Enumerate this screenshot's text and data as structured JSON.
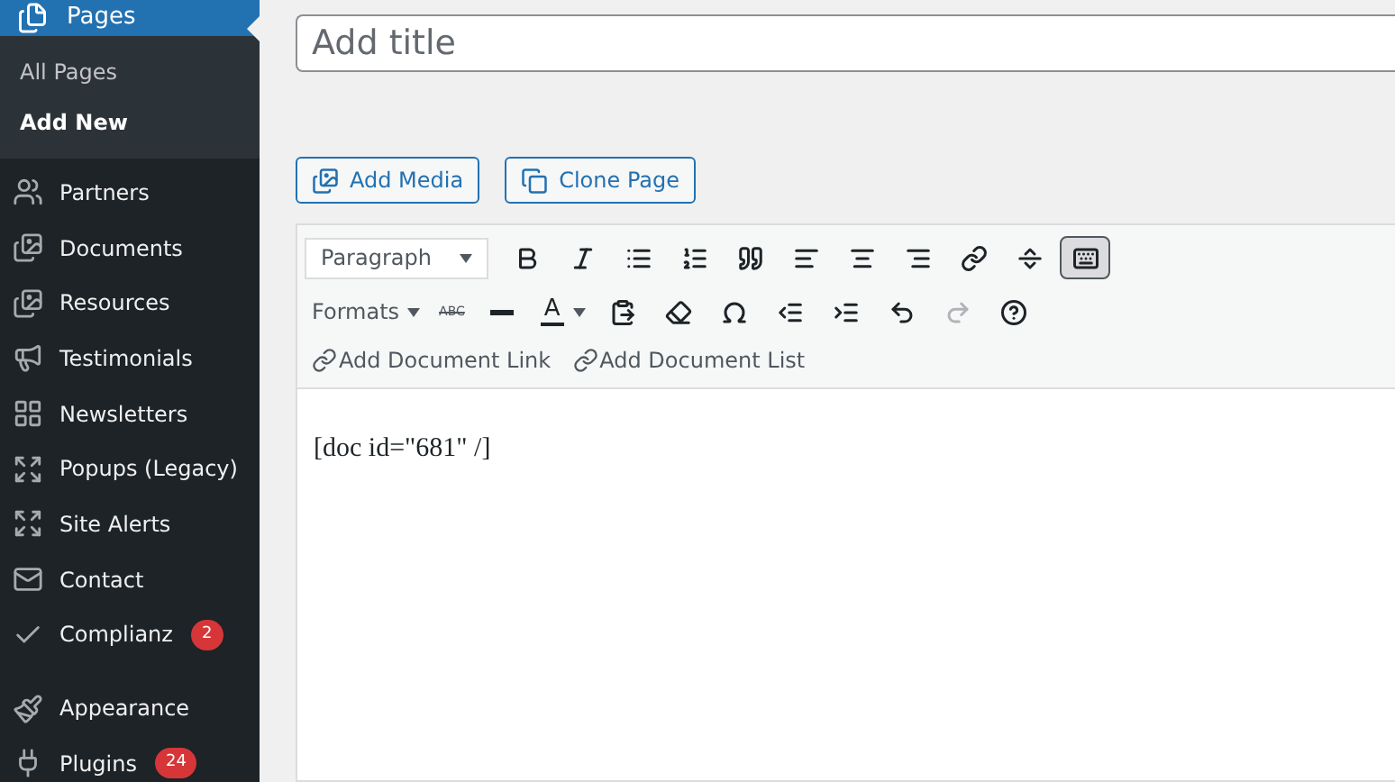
{
  "sidebar": {
    "current": {
      "label": "Pages",
      "selected": true
    },
    "submenu": [
      {
        "label": "All Pages",
        "selected": false
      },
      {
        "label": "Add New",
        "selected": true
      }
    ],
    "items": [
      {
        "kind": "item",
        "label": "Partners"
      },
      {
        "kind": "item",
        "label": "Documents"
      },
      {
        "kind": "item",
        "label": "Resources"
      },
      {
        "kind": "item",
        "label": "Testimonials"
      },
      {
        "kind": "item",
        "label": "Newsletters"
      },
      {
        "kind": "item",
        "label": "Popups (Legacy)"
      },
      {
        "kind": "item",
        "label": "Site Alerts"
      },
      {
        "kind": "item",
        "label": "Contact"
      },
      {
        "kind": "item",
        "label": "Complianz",
        "badge": "2"
      },
      {
        "kind": "separator"
      },
      {
        "kind": "item",
        "label": "Appearance"
      },
      {
        "kind": "item",
        "label": "Plugins",
        "badge": "24"
      }
    ]
  },
  "title_field": {
    "placeholder": "Add title"
  },
  "media_buttons": [
    "Add Media",
    "Clone Page"
  ],
  "editor": {
    "format_select": "Paragraph",
    "toolbar_toggle": {
      "selected": true
    },
    "formats_label": "Formats",
    "strikethrough_label": "ABC",
    "text_color_label": "A",
    "redo": {
      "disabled": true
    },
    "links": [
      "Add Document Link",
      "Add Document List"
    ],
    "content": "[doc id=\"681\" /]"
  }
}
